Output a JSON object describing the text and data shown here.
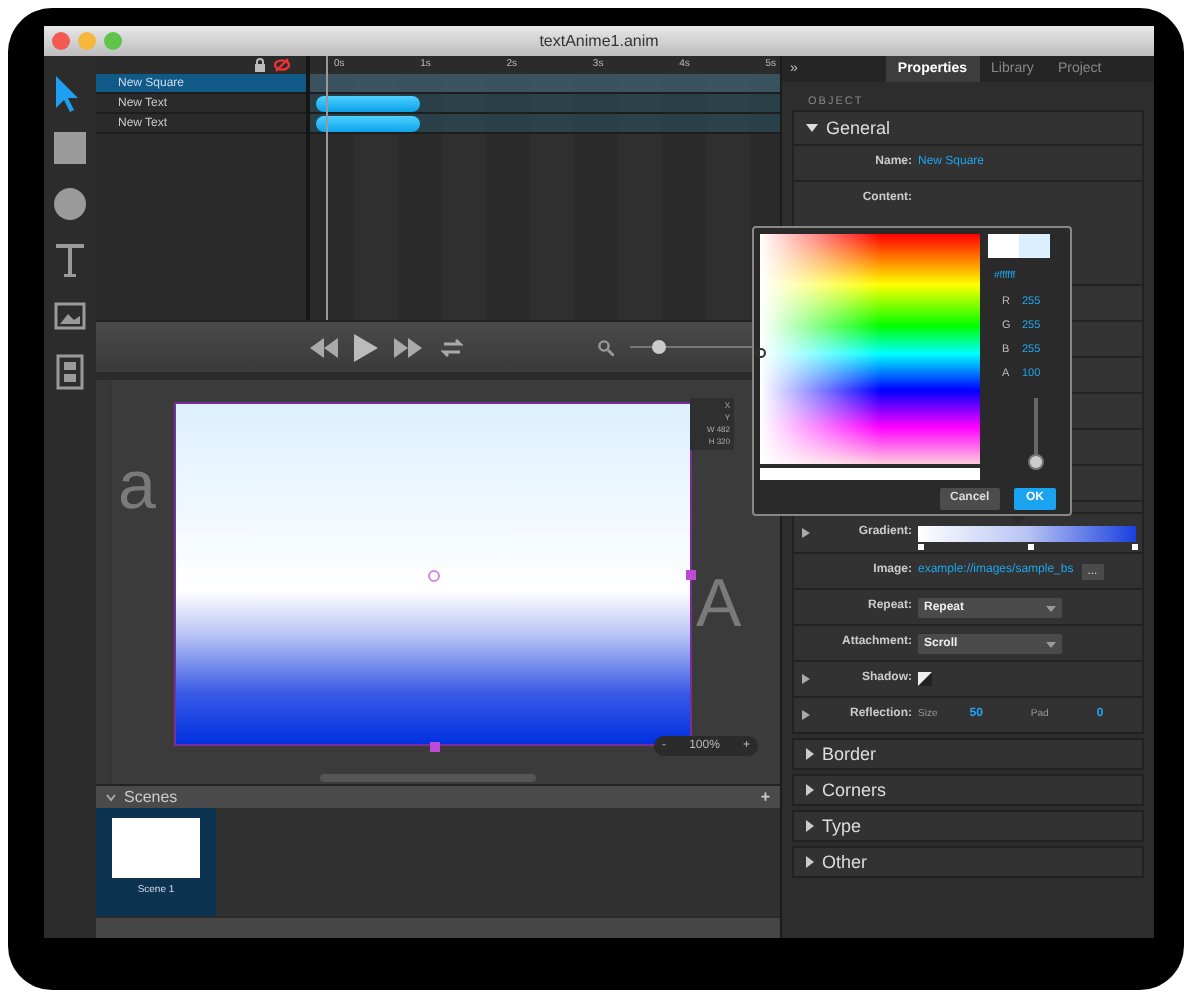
{
  "window": {
    "title": "textAnime1.anim"
  },
  "tools": [
    {
      "kind": "arrow",
      "selected": true
    },
    {
      "kind": "rect",
      "selected": false
    },
    {
      "kind": "circle",
      "selected": false
    },
    {
      "kind": "text",
      "selected": false
    },
    {
      "kind": "image",
      "selected": false
    },
    {
      "kind": "video",
      "selected": false
    }
  ],
  "timeline": {
    "ruler": [
      "0s",
      "1s",
      "2s",
      "3s",
      "4s",
      "5s"
    ],
    "layers": [
      {
        "name": "New Square",
        "selected": true,
        "clip": false
      },
      {
        "name": "New Text",
        "selected": false,
        "clip": true
      },
      {
        "name": "New Text",
        "selected": false,
        "clip": true
      }
    ]
  },
  "transport": {
    "zoom_slider": {
      "level": 0.2
    }
  },
  "stage": {
    "ghost_left": "a",
    "ghost_right": "A",
    "info": [
      "X",
      "Y",
      "W 482",
      "H 320"
    ],
    "zoom": {
      "minus": "-",
      "value": "100%",
      "plus": "+"
    }
  },
  "scenes": {
    "title": "Scenes",
    "add": "+",
    "items": [
      {
        "name": "Scene 1",
        "selected": true
      }
    ]
  },
  "panel": {
    "collapse": "»",
    "tabs": [
      {
        "label": "Properties",
        "selected": true
      },
      {
        "label": "Library",
        "selected": false
      },
      {
        "label": "Project",
        "selected": false
      }
    ],
    "heading": "OBJECT",
    "general": {
      "title": "General",
      "expanded": true,
      "top_rows": [
        {
          "kind": "text",
          "label": "Name:",
          "value": "New Square"
        },
        {
          "kind": "tall",
          "label": "Content:"
        }
      ],
      "rows": [
        {
          "kind": "gradient",
          "label": "Gradient:",
          "expandable": true
        },
        {
          "kind": "link",
          "label": "Image:",
          "value": "example://images/sample_bs",
          "button": "..."
        },
        {
          "kind": "select",
          "label": "Repeat:",
          "value": "Repeat"
        },
        {
          "kind": "select",
          "label": "Attachment:",
          "value": "Scroll"
        },
        {
          "kind": "swatch",
          "label": "Shadow:",
          "expandable": true
        },
        {
          "kind": "reflection",
          "label": "Reflection:",
          "size_label": "Size",
          "size": "50",
          "pad_label": "Pad",
          "pad": "0",
          "expandable": true
        }
      ]
    },
    "sections": [
      {
        "title": "Border",
        "expanded": false
      },
      {
        "title": "Corners",
        "expanded": false
      },
      {
        "title": "Type",
        "expanded": false
      },
      {
        "title": "Other",
        "expanded": false
      }
    ]
  },
  "color_picker": {
    "hex": "#ffffff",
    "channels": [
      {
        "label": "R",
        "value": "255"
      },
      {
        "label": "G",
        "value": "255"
      },
      {
        "label": "B",
        "value": "255"
      },
      {
        "label": "A",
        "value": "100"
      }
    ],
    "alpha_slider": {
      "level": 0.0
    },
    "buttons": [
      {
        "label": "Cancel",
        "primary": false
      },
      {
        "label": "OK",
        "primary": true
      }
    ]
  }
}
